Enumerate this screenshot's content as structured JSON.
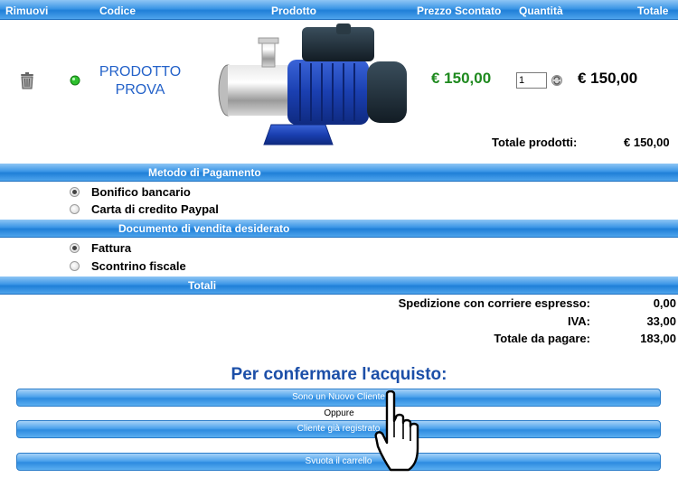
{
  "table_header": {
    "remove": "Rimuovi",
    "code": "Codice",
    "product": "Prodotto",
    "discount_price": "Prezzo Scontato",
    "quantity": "Quantità",
    "total": "Totale"
  },
  "cart_item": {
    "product_name_line1": "PRODOTTO",
    "product_name_line2": "PROVA",
    "discount_price": "€ 150,00",
    "quantity_value": "1",
    "line_total": "€ 150,00",
    "product_image": "electric-pump-product-photo"
  },
  "subtotal": {
    "label": "Totale prodotti:",
    "value": "€ 150,00"
  },
  "payment": {
    "title": "Metodo di Pagamento",
    "options": [
      {
        "label": "Bonifico bancario",
        "selected": true
      },
      {
        "label": "Carta di credito Paypal",
        "selected": false
      }
    ]
  },
  "document": {
    "title": "Documento di vendita desiderato",
    "options": [
      {
        "label": "Fattura",
        "selected": true
      },
      {
        "label": "Scontrino fiscale",
        "selected": false
      }
    ]
  },
  "totals": {
    "title": "Totali",
    "rows": [
      {
        "label": "Spedizione con corriere espresso:",
        "value": "0,00"
      },
      {
        "label": "IVA:",
        "value": "33,00"
      },
      {
        "label": "Totale da pagare:",
        "value": "183,00"
      }
    ]
  },
  "confirm": {
    "heading": "Per confermare l'acquisto:",
    "new_customer_button": "Sono un Nuovo Cliente",
    "or_text": "Oppure",
    "registered_button": "Cliente già registrato",
    "empty_cart_button": "Svuota il carrello"
  },
  "colors": {
    "bar_blue": "#2d8be0",
    "price_green": "#1f8a1f",
    "product_link_blue": "#2462c9",
    "heading_blue": "#1c4fa8"
  },
  "icons": [
    "trash-icon",
    "green-status-icon",
    "refresh-icon",
    "hand-cursor-icon"
  ]
}
